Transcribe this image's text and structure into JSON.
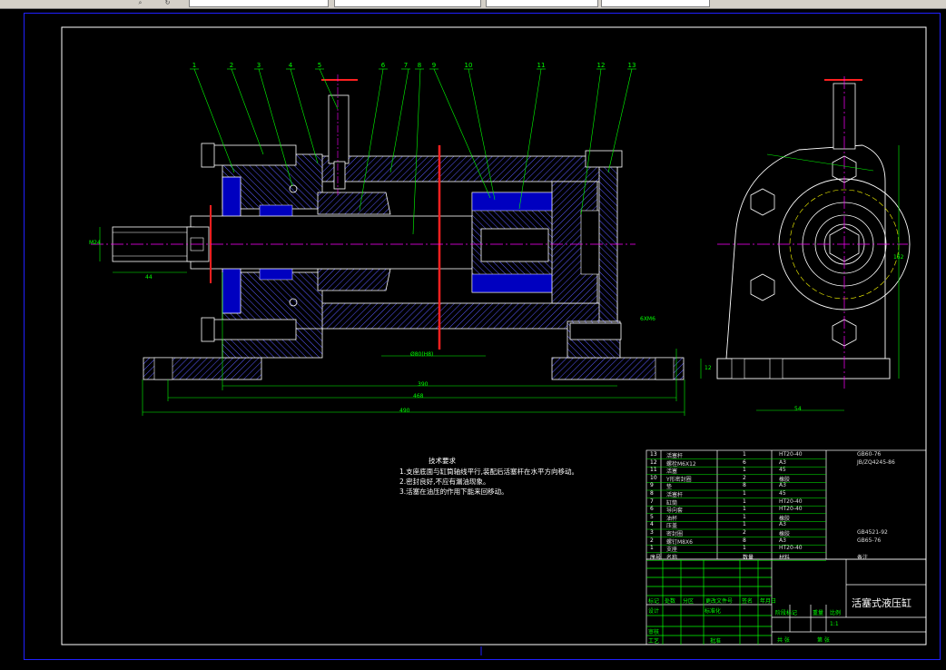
{
  "app": {
    "toolbar_label": "",
    "toolbar_icon_1": "search-icon",
    "toolbar_icon_2": "refresh-icon"
  },
  "drawing": {
    "title": "活塞式液压缸",
    "colors": {
      "background": "#000000",
      "frame": "#ffffff",
      "section": "#0000c0",
      "hatch": "#6060ff",
      "dimension": "#00ff00",
      "centerline": "#ff00ff",
      "cutting": "#ff0000",
      "leader": "#ffff00",
      "viewport_border": "#2020ff"
    },
    "balloons": [
      "1",
      "2",
      "3",
      "4",
      "5",
      "6",
      "7",
      "8",
      "9",
      "10",
      "11",
      "12",
      "13"
    ],
    "dimensions": {
      "overall": "490",
      "middle": "468",
      "inner": "390",
      "rod_length": "44",
      "stroke": "Ø80(H8)",
      "thread_left": "M24",
      "side_height": "152",
      "side_bottom": "54",
      "side_base": "12",
      "hole_spec": "6XM6"
    },
    "notes": {
      "heading": "技术要求",
      "items": [
        "1.支座底面与缸筒轴线平行,装配后活塞杆在水平方向移动。",
        "2.密封良好,不应有漏油现象。",
        "3.活塞在油压的作用下能来回移动。"
      ]
    },
    "bom": [
      {
        "no": "13",
        "name": "活塞杆",
        "qty": "1",
        "material": "HT20-40",
        "standard": "GB60-76"
      },
      {
        "no": "12",
        "name": "螺栓M6X12",
        "qty": "6",
        "material": "A3",
        "standard": "JB/ZQ4245-86"
      },
      {
        "no": "11",
        "name": "活塞",
        "qty": "1",
        "material": "45",
        "standard": ""
      },
      {
        "no": "10",
        "name": "Y形密封圈",
        "qty": "2",
        "material": "橡胶",
        "standard": ""
      },
      {
        "no": "9",
        "name": "垫",
        "qty": "8",
        "material": "A3",
        "standard": ""
      },
      {
        "no": "8",
        "name": "活塞杆",
        "qty": "1",
        "material": "45",
        "standard": ""
      },
      {
        "no": "7",
        "name": "缸筒",
        "qty": "1",
        "material": "HT20-40",
        "standard": ""
      },
      {
        "no": "6",
        "name": "导向套",
        "qty": "1",
        "material": "HT20-40",
        "standard": ""
      },
      {
        "no": "5",
        "name": "油杯",
        "qty": "1",
        "material": "橡胶",
        "standard": ""
      },
      {
        "no": "4",
        "name": "压盖",
        "qty": "1",
        "material": "A3",
        "standard": ""
      },
      {
        "no": "3",
        "name": "密封圈",
        "qty": "2",
        "material": "橡胶",
        "standard": "GB4521-92"
      },
      {
        "no": "2",
        "name": "螺钉M8X6",
        "qty": "8",
        "material": "A3",
        "standard": "GB65-76"
      },
      {
        "no": "1",
        "name": "支座",
        "qty": "1",
        "material": "HT20-40",
        "standard": ""
      }
    ],
    "bom_header": {
      "no": "序号",
      "name": "名称",
      "qty": "数量",
      "material": "材料",
      "standard": "备注"
    },
    "title_block": {
      "row1": [
        "标记",
        "处数",
        "分区",
        "更改文件号",
        "签名",
        "年月日"
      ],
      "design": "设计",
      "standardize": "标准化",
      "review": "审核",
      "process": "工艺",
      "approve": "批准",
      "stage": "阶段标记",
      "weight": "重量",
      "scale": "比例",
      "scale_value": "1:1",
      "sheets": "共 张",
      "sheet_no": "第 张"
    }
  }
}
